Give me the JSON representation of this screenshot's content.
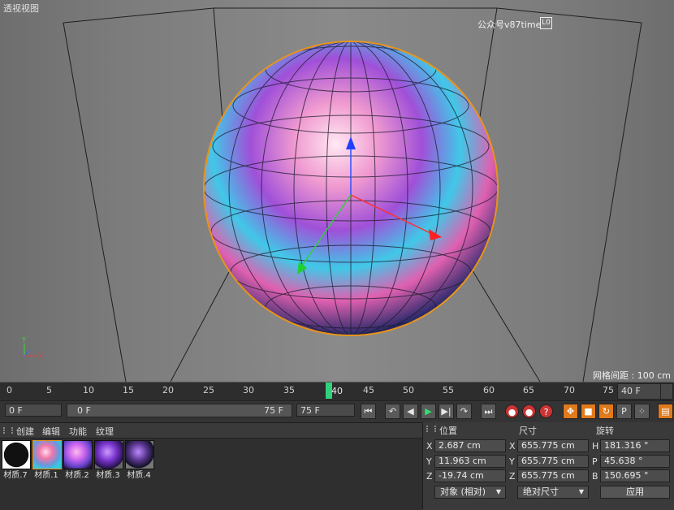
{
  "viewport": {
    "title": "透视视图",
    "watermark": "公众号v87time",
    "camera_badge": "L0",
    "grid_spacing": "网格间距 : 100 cm"
  },
  "timeline": {
    "ticks": [
      "0",
      "5",
      "10",
      "15",
      "20",
      "25",
      "30",
      "35",
      "40",
      "45",
      "50",
      "55",
      "60",
      "65",
      "70",
      "75"
    ],
    "current_frame": "40",
    "end_frame_field": "40 F",
    "start_field": "0 F",
    "range_start": "0 F",
    "range_end": "75 F",
    "end_field": "75 F"
  },
  "materials": {
    "menu": [
      "创建",
      "编辑",
      "功能",
      "纹理"
    ],
    "items": [
      {
        "label": "材质.7"
      },
      {
        "label": "材质.1"
      },
      {
        "label": "材质.2"
      },
      {
        "label": "材质.3"
      },
      {
        "label": "材质.4"
      }
    ]
  },
  "coords": {
    "headers": {
      "position": "位置",
      "size": "尺寸",
      "rotation": "旋转"
    },
    "position": {
      "x": "2.687 cm",
      "y": "11.963 cm",
      "z": "-19.74 cm"
    },
    "size": {
      "x": "655.775 cm",
      "y": "655.775 cm",
      "z": "655.775 cm"
    },
    "rotation": {
      "h": "181.316 °",
      "p": "45.638 °",
      "b": "150.695 °"
    },
    "mode_dropdown": "对象 (相对)",
    "size_dropdown": "绝对尺寸",
    "apply_button": "应用"
  },
  "colors": {
    "playhead": "#2fd27a",
    "sphere_outline": "#e8941a"
  }
}
